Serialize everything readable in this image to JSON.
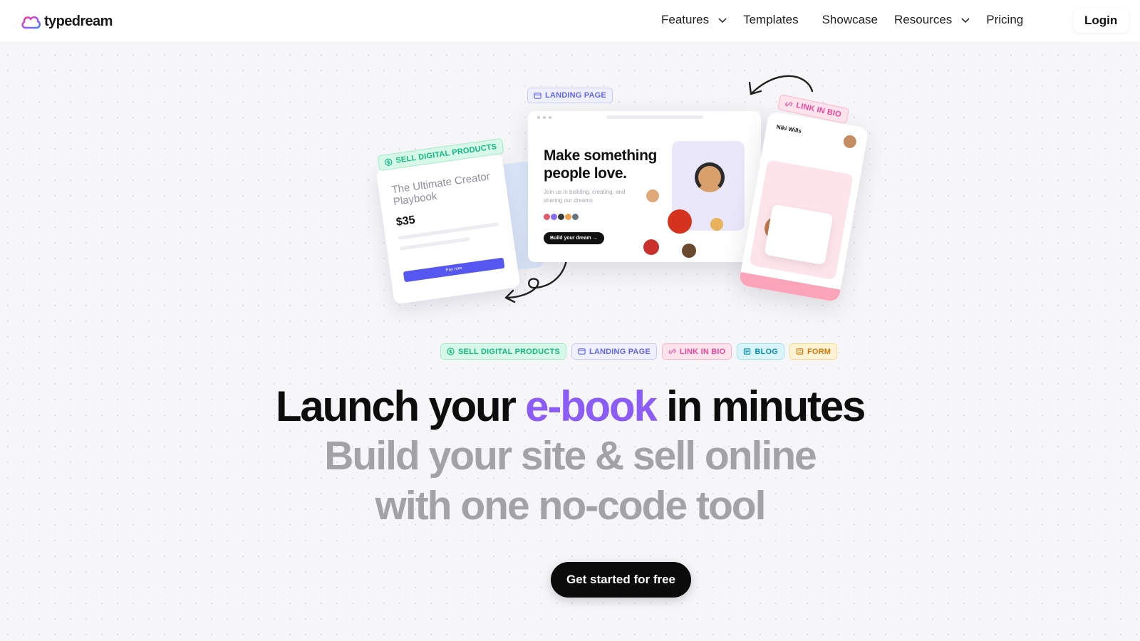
{
  "brand": {
    "name": "typedream"
  },
  "nav": {
    "features": "Features",
    "templates": "Templates",
    "showcase": "Showcase",
    "resources": "Resources",
    "pricing": "Pricing",
    "login": "Login"
  },
  "illustration": {
    "tag_sell": "SELL DIGITAL PRODUCTS",
    "tag_landing": "LANDING PAGE",
    "tag_bio": "LINK IN BIO",
    "product_title": "The Ultimate Creator Playbook",
    "product_price": "$35",
    "product_pay": "Pay now",
    "landing_heading": "Make something people love.",
    "landing_sub": "Join us in building, creating, and sharing our dreams",
    "landing_button": "Build your dream →",
    "bio_name": "Niki Wills"
  },
  "chips": {
    "sell": "SELL DIGITAL PRODUCTS",
    "landing": "LANDING PAGE",
    "bio": "LINK IN BIO",
    "blog": "BLOG",
    "form": "FORM"
  },
  "hero": {
    "line1_prefix": "Launch your",
    "line1_accent": "e-book",
    "line1_suffix": "in minutes",
    "line2": "Build your site & sell online",
    "line3": "with one no-code tool",
    "cta": "Get started for free"
  },
  "colors": {
    "accent": "#8b5cf6",
    "cta_bg": "#0b0b0b",
    "chip_green": "#10b981",
    "chip_indigo": "#6366f1",
    "chip_pink": "#ec4899",
    "chip_cyan": "#0891b2",
    "chip_amber": "#d97706"
  }
}
